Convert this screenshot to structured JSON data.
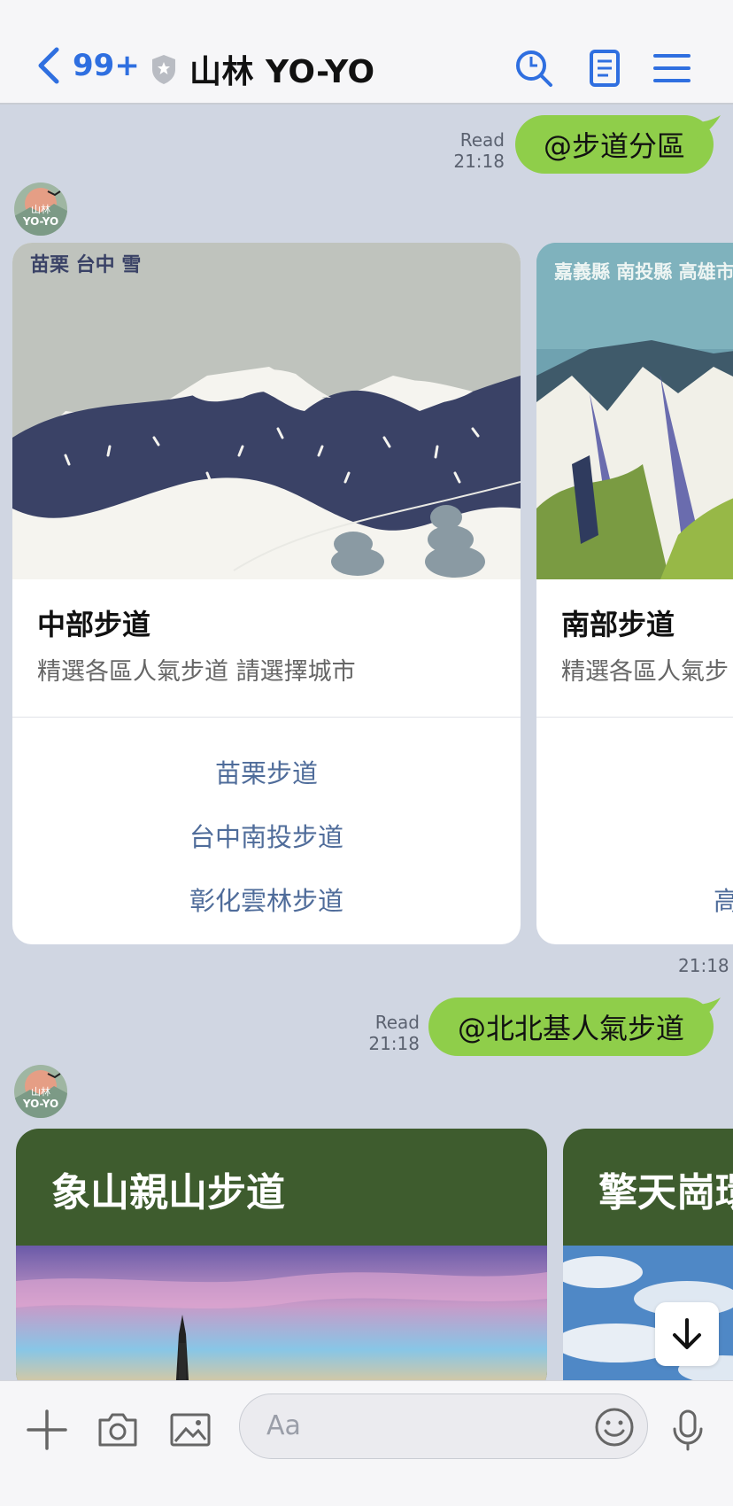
{
  "header": {
    "back_count": "99+",
    "title": "山林 YO-YO",
    "icons": [
      "chevron-left-icon",
      "shield-icon",
      "search-icon",
      "notes-icon",
      "menu-icon"
    ]
  },
  "messages": [
    {
      "type": "outgoing",
      "read": "Read",
      "time": "21:18",
      "text": "@步道分區"
    },
    {
      "type": "incoming-carousel",
      "avatar_text": "山林 YO-YO",
      "time": "21:18",
      "cards": [
        {
          "image_caption": "苗栗 台中 雪",
          "title": "中部步道",
          "subtitle": "精選各區人氣步道 請選擇城市",
          "buttons": [
            "苗栗步道",
            "台中南投步道",
            "彰化雲林步道"
          ]
        },
        {
          "image_caption": "嘉義縣 南投縣 高雄市",
          "title": "南部步道",
          "subtitle": "精選各區人氣步",
          "buttons": [
            "高"
          ]
        }
      ]
    },
    {
      "type": "outgoing",
      "read": "Read",
      "time": "21:18",
      "text": "@北北基人氣步道"
    },
    {
      "type": "incoming-carousel",
      "avatar_text": "山林 YO-YO",
      "cards": [
        {
          "title": "象山親山步道"
        },
        {
          "title": "擎天崗環"
        }
      ]
    }
  ],
  "composer": {
    "placeholder": "Aa",
    "icons": [
      "plus-icon",
      "camera-icon",
      "image-icon",
      "emoji-icon",
      "microphone-icon"
    ]
  },
  "colors": {
    "accent": "#2f6fe0",
    "bubble": "#8fce4a",
    "chat_bg": "#d0d6e2",
    "card_header_green": "#3e5c2e",
    "link": "#4f6c9a"
  }
}
